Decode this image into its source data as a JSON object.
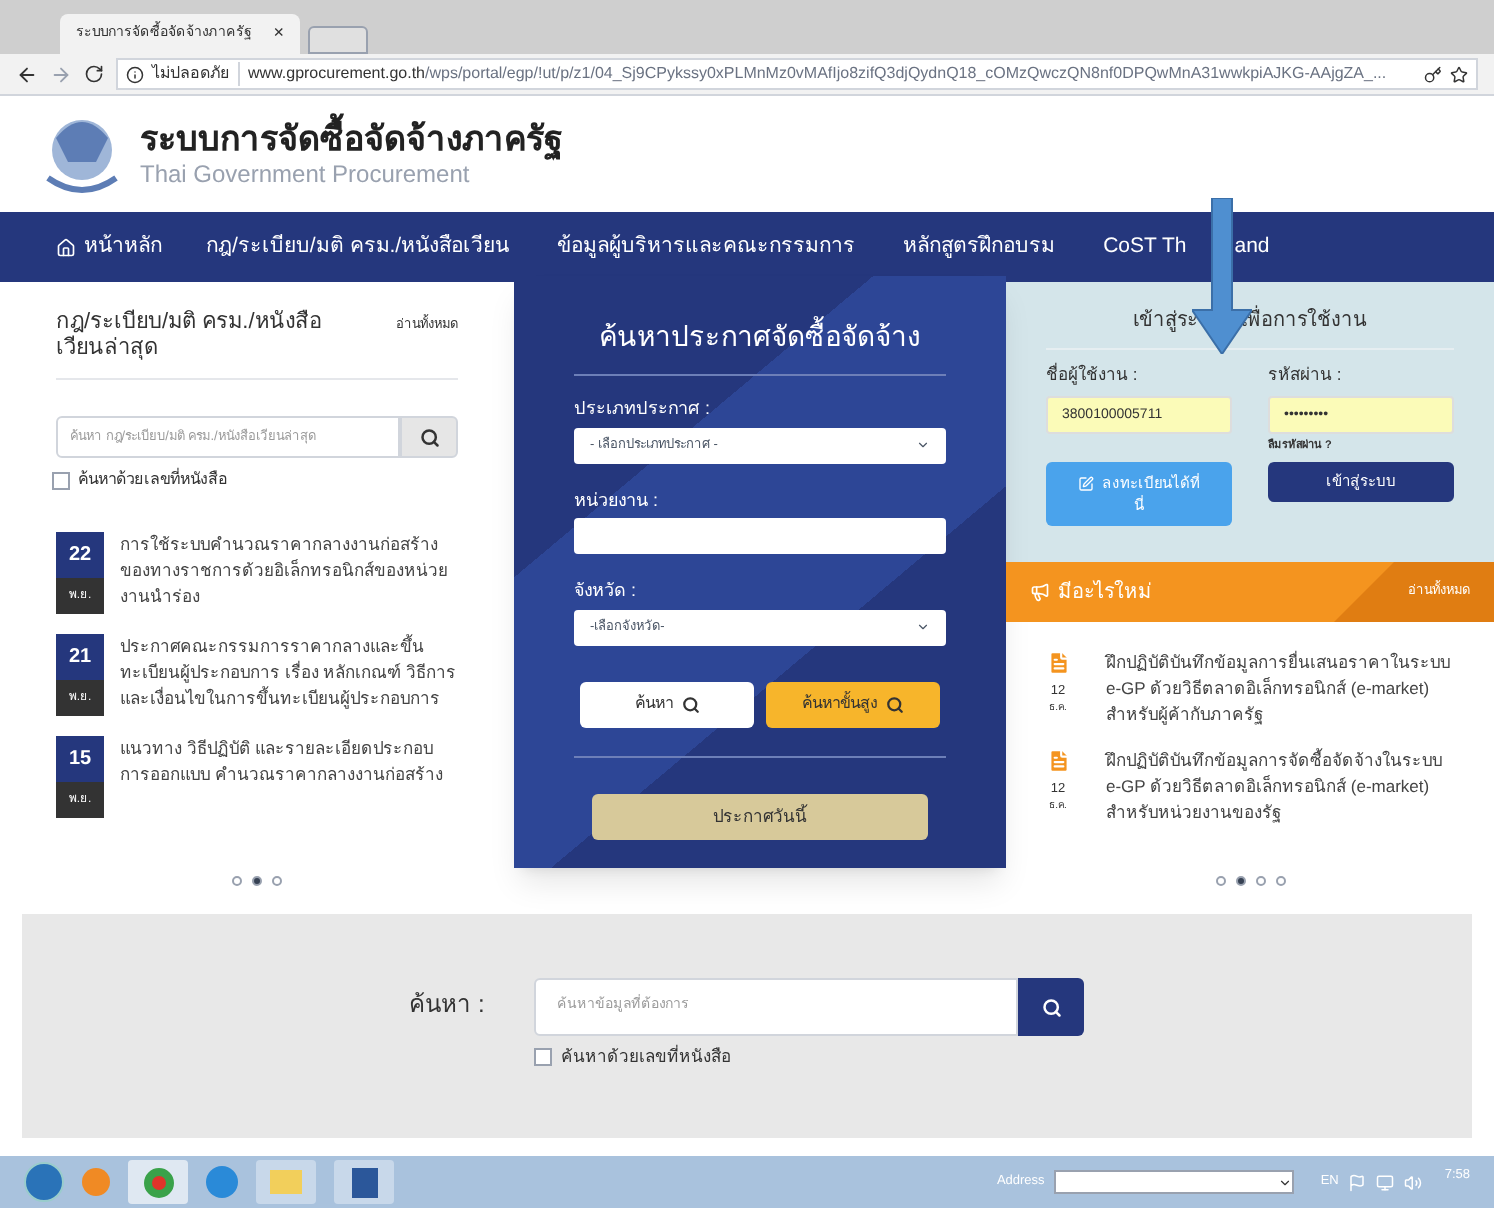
{
  "browser": {
    "tab_title": "ระบบการจัดซื้อจัดจ้างภาครัฐ",
    "tab_close": "×",
    "security": "ไม่ปลอดภัย",
    "url_host": "www.gprocurement.go.th",
    "url_path": "/wps/portal/egp/!ut/p/z1/04_Sj9CPykssy0xPLMnMz0vMAfIjo8zifQ3djQydnQ18_cOMzQwczQN8nf0DPQwMnA31wwkpiAJKG-AAjgZA_..."
  },
  "header": {
    "title": "ระบบการจัดซื้อจัดจ้างภาครัฐ",
    "subtitle": "Thai Government Procurement"
  },
  "nav": [
    {
      "label": "หน้าหลัก",
      "kind": "home"
    },
    {
      "label": "กฎ/ระเบียบ/มติ ครม./หนังสือเวียน",
      "kind": "text"
    },
    {
      "label": "ข้อมูลผู้บริหารและคณะกรรมการ",
      "kind": "text"
    },
    {
      "label": "หลักสูตรฝึกอบรม",
      "kind": "text"
    },
    {
      "label": "CoST Th",
      "kind": "text"
    },
    {
      "label": "and",
      "kind": "text"
    }
  ],
  "laws": {
    "title": "กฎ/ระเบียบ/มติ ครม./หนังสือเวียนล่าสุด",
    "read_all": "อ่านทั้งหมด",
    "search_placeholder": "ค้นหา กฎ/ระเบียบ/มติ ครม./หนังสือเวียนล่าสุด",
    "by_number": {
      "label": "ค้นหาด้วยเลขที่หนังสือ",
      "checked": false
    },
    "items": [
      {
        "day": "22",
        "month": "พ.ย.",
        "text": "การใช้ระบบคำนวณราคากลางงานก่อสร้างของทางราชการด้วยอิเล็กทรอนิกส์ของหน่วยงานนำร่อง"
      },
      {
        "day": "21",
        "month": "พ.ย.",
        "text": "ประกาศคณะกรรมการราคากลางและขึ้นทะเบียนผู้ประกอบการ เรื่อง หลักเกณฑ์ วิธีการและเงื่อนไขในการขึ้นทะเบียนผู้ประกอบการ"
      },
      {
        "day": "15",
        "month": "พ.ย.",
        "text": "แนวทาง วิธีปฏิบัติ และรายละเอียดประกอบการออกแบบ คำนวณราคากลางงานก่อสร้าง"
      }
    ],
    "pager": [
      {
        "selected": false
      },
      {
        "selected": true
      },
      {
        "selected": false
      }
    ]
  },
  "announce": {
    "title": "ค้นหาประกาศจัดซื้อจัดจ้าง",
    "type_label": "ประเภทประกาศ :",
    "type_value": "- เลือกประเภทประกาศ -",
    "agency_label": "หน่วยงาน :",
    "province_label": "จังหวัด :",
    "province_value": "-เลือกจังหวัด-",
    "search": "ค้นหา",
    "advanced": "ค้นหาขั้นสูง",
    "today": "ประกาศวันนี้"
  },
  "login": {
    "title_left": "เข้าสู่ระ",
    "title_right": "เพื่อการใช้งาน",
    "user_label": "ชื่อผู้ใช้งาน :",
    "user_value": "3800100005711",
    "pass_label": "รหัสผ่าน :",
    "pass_value": "•••••••••",
    "forgot": "ลืมรหัสผ่าน ?",
    "register_line1": "ลงทะเบียนได้ที่",
    "register_line2": "นี่",
    "submit": "เข้าสู่ระบบ"
  },
  "news": {
    "title": "มีอะไรใหม่",
    "read_all": "อ่านทั้งหมด",
    "items": [
      {
        "day": "12",
        "month": "ธ.ค.",
        "text": "ฝึกปฏิบัติบันทึกข้อมูลการยื่นเสนอราคาในระบบ e-GP ด้วยวิธีตลาดอิเล็กทรอนิกส์ (e-market) สำหรับผู้ค้ากับภาครัฐ"
      },
      {
        "day": "12",
        "month": "ธ.ค.",
        "text": "ฝึกปฏิบัติบันทึกข้อมูลการจัดซื้อจัดจ้างในระบบ e-GP ด้วยวิธีตลาดอิเล็กทรอนิกส์ (e-market) สำหรับหน่วยงานของรัฐ"
      }
    ],
    "pager": [
      {
        "selected": false
      },
      {
        "selected": true
      },
      {
        "selected": false
      },
      {
        "selected": false
      }
    ]
  },
  "site_search": {
    "label": "ค้นหา :",
    "placeholder": "ค้นหาข้อมูลที่ต้องการ",
    "by_number": {
      "label": "ค้นหาด้วยเลขที่หนังสือ",
      "checked": false
    }
  },
  "taskbar": {
    "address_label": "Address",
    "language": "EN",
    "time": "7:58"
  }
}
